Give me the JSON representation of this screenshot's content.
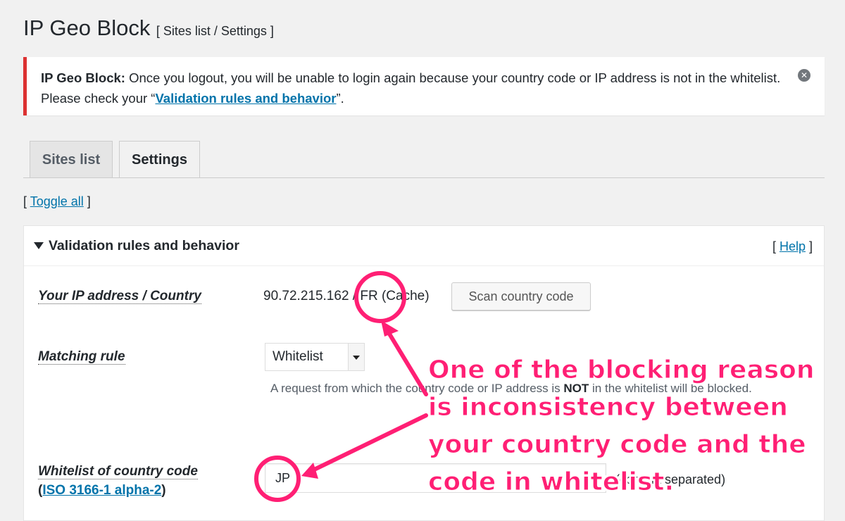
{
  "header": {
    "title": "IP Geo Block",
    "subtitle": "[ Sites list / Settings ]"
  },
  "notice": {
    "strong": "IP Geo Block:",
    "text_before": " Once you logout, you will be unable to login again because your country code or IP address is not in the whitelist. Please check your “",
    "link_text": "Validation rules and behavior",
    "text_after": "”.",
    "dismiss_symbol": "✕"
  },
  "tabs": [
    {
      "label": "Sites list"
    },
    {
      "label": "Settings"
    }
  ],
  "toggle_all": {
    "open": "[ ",
    "link": "Toggle all",
    "close": " ]"
  },
  "panel": {
    "title": "Validation rules and behavior",
    "help_open": "[ ",
    "help_link": "Help",
    "help_close": " ]",
    "ip_label": "Your IP address / Country",
    "ip_value": "90.72.215.162 / FR (Cache)",
    "scan_button": "Scan country code",
    "matching_label": "Matching rule",
    "matching_value": "Whitelist",
    "desc_before": "A request from which the country code or IP address is ",
    "desc_strong": "NOT",
    "desc_after": " in the whitelist will be blocked.",
    "whitelist_label": "Whitelist of country code",
    "iso_open": "(",
    "iso_link": "ISO 3166-1 alpha-2",
    "iso_close": ")",
    "whitelist_value": "JP",
    "comma_note": "(comma separated)"
  },
  "annotation": {
    "text": "One of the blocking reason is inconsistency between your country code and the code in whitelist.",
    "color": "#ff1f74"
  }
}
